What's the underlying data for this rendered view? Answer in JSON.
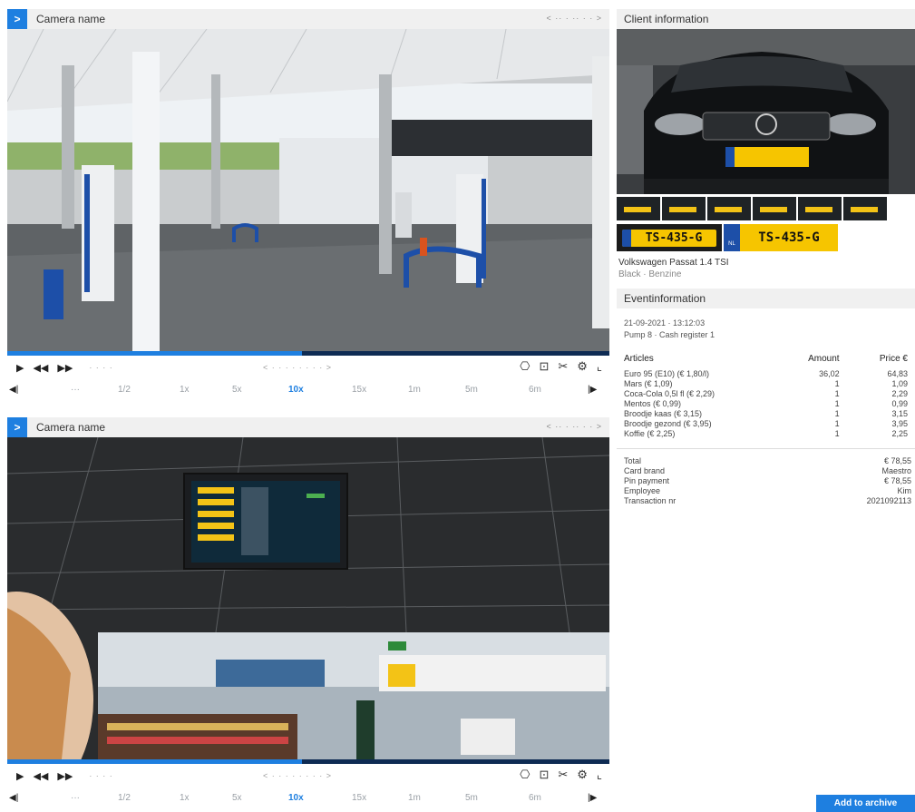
{
  "cameras": [
    {
      "expand_icon": ">",
      "name": "Camera name",
      "header_nav": "< ·· · ·· · · >",
      "progress_fraction": 0.49,
      "controls": {
        "play": "▶",
        "rewind": "◀◀",
        "fast_forward": "▶▶",
        "small_label": "· · · ·",
        "nav": "<  · · · · · · · ·  >",
        "icons": [
          "capture-icon",
          "snapshot-icon",
          "tools-icon",
          "settings-icon",
          "fullscreen-icon"
        ]
      },
      "speeds": [
        "◀|",
        "···",
        "1/2",
        "1x",
        "5x",
        "10x",
        "15x",
        "1m",
        "5m",
        "6m",
        "|▶"
      ],
      "active_speed": "10x"
    },
    {
      "expand_icon": ">",
      "name": "Camera name",
      "header_nav": "< ·· · ·· · · >",
      "progress_fraction": 0.49,
      "controls": {
        "play": "▶",
        "rewind": "◀◀",
        "fast_forward": "▶▶",
        "small_label": "· · · ·",
        "nav": "<  · · · · · · · ·  >",
        "icons": [
          "capture-icon",
          "snapshot-icon",
          "tools-icon",
          "settings-icon",
          "fullscreen-icon"
        ]
      },
      "speeds": [
        "◀|",
        "···",
        "1/2",
        "1x",
        "5x",
        "10x",
        "15x",
        "1m",
        "5m",
        "6m",
        "|▶"
      ],
      "active_speed": "10x"
    }
  ],
  "client": {
    "title": "Client information",
    "plate_text": "TS-435-G",
    "plate_country": "NL",
    "vehicle": "Volkswagen Passat 1.4 TSI",
    "vehicle_sub": "Black · Benzine"
  },
  "event": {
    "title": "Eventinformation",
    "datetime": "21-09-2021 · 13:12:03",
    "pump": "Pump 8 · Cash register 1",
    "columns": {
      "article": "Articles",
      "amount": "Amount",
      "price": "Price €"
    },
    "rows": [
      {
        "article": "Euro 95 (E10) (€ 1,80/l)",
        "amount": "36,02",
        "price": "64,83"
      },
      {
        "article": "Mars (€ 1,09)",
        "amount": "1",
        "price": "1,09"
      },
      {
        "article": "Coca-Cola 0,5l fl (€ 2,29)",
        "amount": "1",
        "price": "2,29"
      },
      {
        "article": "Mentos (€ 0,99)",
        "amount": "1",
        "price": "0,99"
      },
      {
        "article": "Broodje kaas (€ 3,15)",
        "amount": "1",
        "price": "3,15"
      },
      {
        "article": "Broodje gezond (€ 3,95)",
        "amount": "1",
        "price": "3,95"
      },
      {
        "article": "Koffie (€ 2,25)",
        "amount": "1",
        "price": "2,25"
      }
    ],
    "totals": [
      {
        "label": "Total",
        "value": "€ 78,55"
      },
      {
        "label": "Card brand",
        "value": "Maestro"
      },
      {
        "label": "Pin payment",
        "value": "€ 78,55"
      },
      {
        "label": "Employee",
        "value": "Kim"
      },
      {
        "label": "Transaction nr",
        "value": "2021092113"
      }
    ]
  },
  "archive_button": "Add to archive",
  "colors": {
    "accent": "#1e7fe0",
    "plate": "#f6c500",
    "progress_bg": "#0e2b53"
  }
}
